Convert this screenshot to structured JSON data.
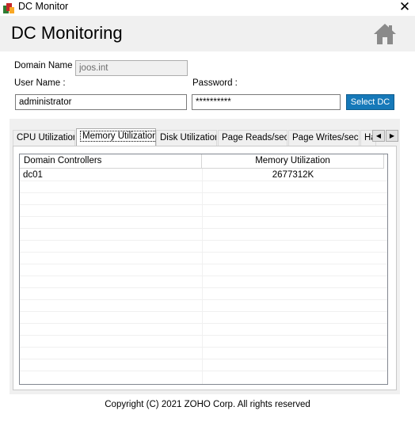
{
  "window": {
    "title": "DC Monitor",
    "close_symbol": "✕"
  },
  "header": {
    "heading": "DC Monitoring"
  },
  "form": {
    "domain_label": "Domain Name :",
    "domain_value": "joos.int",
    "user_label": "User Name :",
    "user_value": "administrator",
    "password_label": "Password :",
    "password_value": "**********",
    "select_button": "Select DC"
  },
  "tabs": [
    {
      "label": "CPU Utilization",
      "active": false
    },
    {
      "label": "Memory Utilization",
      "active": true
    },
    {
      "label": "Disk Utilization",
      "active": false
    },
    {
      "label": "Page Reads/sec",
      "active": false
    },
    {
      "label": "Page Writes/sec",
      "active": false
    },
    {
      "label": "Ha",
      "active": false
    }
  ],
  "tab_scroll": {
    "left": "◀",
    "right": "▶"
  },
  "grid": {
    "columns": [
      "Domain Controllers",
      "Memory Utilization"
    ],
    "rows": [
      [
        "dc01",
        "2677312K"
      ]
    ]
  },
  "footer": {
    "copyright": "Copyright (C) 2021 ZOHO Corp. All rights reserved"
  },
  "colors": {
    "accent": "#1679b9",
    "header_bg": "#f0f0f0"
  },
  "icons": {
    "app": "app-icon",
    "home": "home-icon"
  }
}
